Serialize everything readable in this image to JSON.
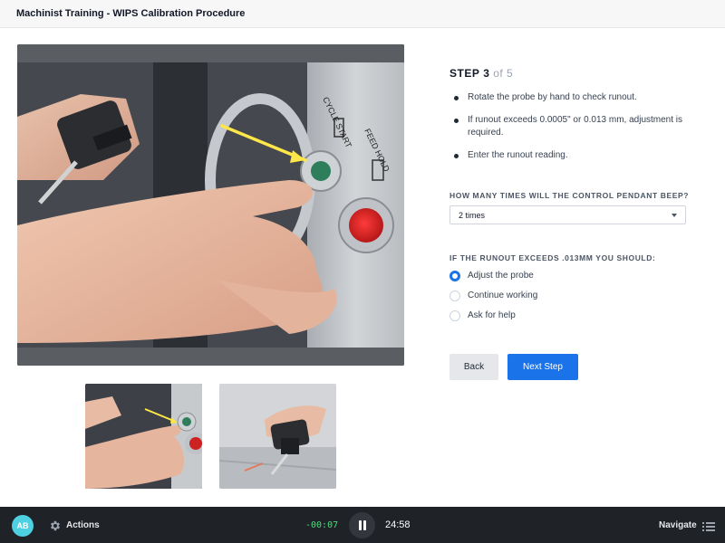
{
  "header": {
    "title": "Machinist Training - WIPS Calibration Procedure"
  },
  "step": {
    "label": "STEP",
    "current": "3",
    "of_text": "of 5"
  },
  "instructions": [
    "Rotate the probe by hand to check runout.",
    "If runout exceeds 0.0005\" or 0.013 mm, adjustment is required.",
    "Enter the runout reading."
  ],
  "question1": {
    "label": "HOW MANY TIMES WILL THE CONTROL PENDANT BEEP?",
    "selected": "2 times"
  },
  "question2": {
    "label": "IF THE RUNOUT EXCEEDS .013MM YOU SHOULD:",
    "options": [
      "Adjust the probe",
      "Continue working",
      "Ask for help"
    ],
    "selected_index": 0
  },
  "buttons": {
    "back": "Back",
    "next": "Next Step"
  },
  "player": {
    "avatar_initials": "AB",
    "actions_label": "Actions",
    "elapsed": "-00:07",
    "remaining": "24:58",
    "navigate_label": "Navigate"
  },
  "image_text": {
    "cycle_start": "CYCLE START",
    "feed_hold": "FEED HOLD"
  },
  "icons": {
    "actions": "gear-icon",
    "pause": "pause-icon",
    "navigate": "list-icon",
    "dropdown": "caret-down-icon"
  },
  "colors": {
    "accent": "#1a73e8",
    "bottom_bar": "#1f2226",
    "elapsed_text": "#4ade80",
    "avatar": "#4dd0e1"
  }
}
